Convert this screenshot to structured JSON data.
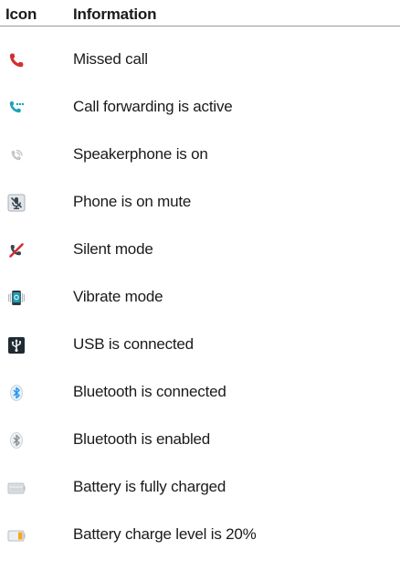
{
  "header": {
    "icon_label": "Icon",
    "info_label": "Information"
  },
  "rows": [
    {
      "icon": "missed-call-icon",
      "text": "Missed call"
    },
    {
      "icon": "call-forwarding-icon",
      "text": "Call forwarding is active"
    },
    {
      "icon": "speakerphone-icon",
      "text": "Speakerphone is on"
    },
    {
      "icon": "microphone-mute-icon",
      "text": "Phone is on mute"
    },
    {
      "icon": "silent-mode-icon",
      "text": "Silent mode"
    },
    {
      "icon": "vibrate-mode-icon",
      "text": "Vibrate mode"
    },
    {
      "icon": "usb-icon",
      "text": "USB is connected"
    },
    {
      "icon": "bluetooth-connected-icon",
      "text": "Bluetooth is connected"
    },
    {
      "icon": "bluetooth-enabled-icon",
      "text": "Bluetooth is enabled"
    },
    {
      "icon": "battery-full-icon",
      "text": "Battery is fully charged"
    },
    {
      "icon": "battery-20-icon",
      "text": "Battery charge level is 20%"
    }
  ],
  "colors": {
    "missed_call": "#d32f2f",
    "call_forward": "#1aa3b8",
    "bluetooth": "#2196f3",
    "battery_low": "#f5a623"
  }
}
